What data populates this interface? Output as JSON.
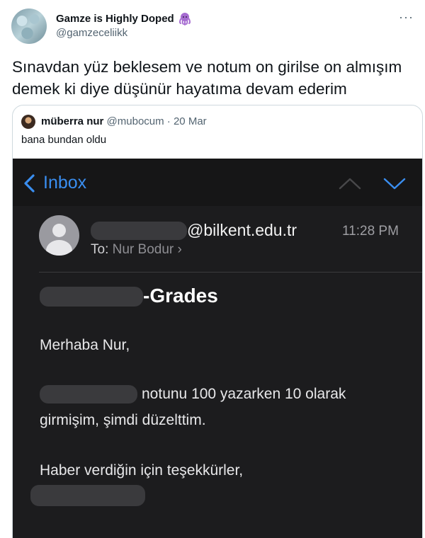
{
  "tweet": {
    "display_name": "Gamze is Highly Doped",
    "handle": "@gamzeceliikk",
    "more_label": "···",
    "text": "Sınavdan yüz beklesem ve notum on girilse on almışım demek ki diye düşünür hayatıma devam ederim"
  },
  "quoted": {
    "display_name": "müberra nur",
    "handle": "@mubocum",
    "separator": "·",
    "date": "20 Mar",
    "text": "bana bundan oldu"
  },
  "mail": {
    "back_label": "Inbox",
    "sender_domain": "@bilkent.edu.tr",
    "time": "11:28 PM",
    "to_label": "To:",
    "recipient": "Nur Bodur",
    "recipient_chevron": "›",
    "subject": "-Grades",
    "greeting": "Merhaba Nur,",
    "body_line1": "notunu 100 yazarken 10 olarak",
    "body_line2": "girmişim, şimdi düzelttim.",
    "closing": "Haber verdiğin için teşekkürler,"
  },
  "colors": {
    "accent_blue": "#3a8ef0",
    "mail_background": "#1c1c1e",
    "octopus_purple": "#a66cd1"
  }
}
